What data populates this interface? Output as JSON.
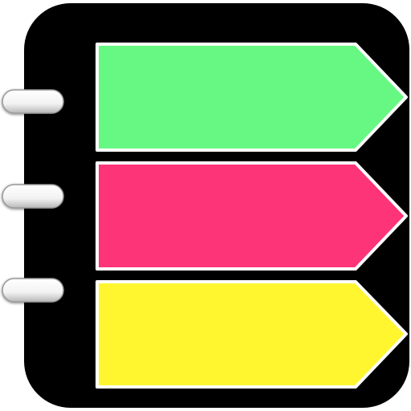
{
  "icon": {
    "name": "notebook-tabs-icon",
    "colors": {
      "background": "#ffffff",
      "cover": "#000000",
      "ring": "#ffffff",
      "ring_shadow": "#888888",
      "tab_outline": "#ffffff",
      "tab_top": "#66f883",
      "tab_middle": "#fd3478",
      "tab_bottom": "#fff630"
    },
    "rings": [
      "ring-top",
      "ring-middle",
      "ring-bottom"
    ],
    "tabs": [
      {
        "name": "tab-green",
        "color_key": "tab_top"
      },
      {
        "name": "tab-pink",
        "color_key": "tab_middle"
      },
      {
        "name": "tab-yellow",
        "color_key": "tab_bottom"
      }
    ]
  }
}
